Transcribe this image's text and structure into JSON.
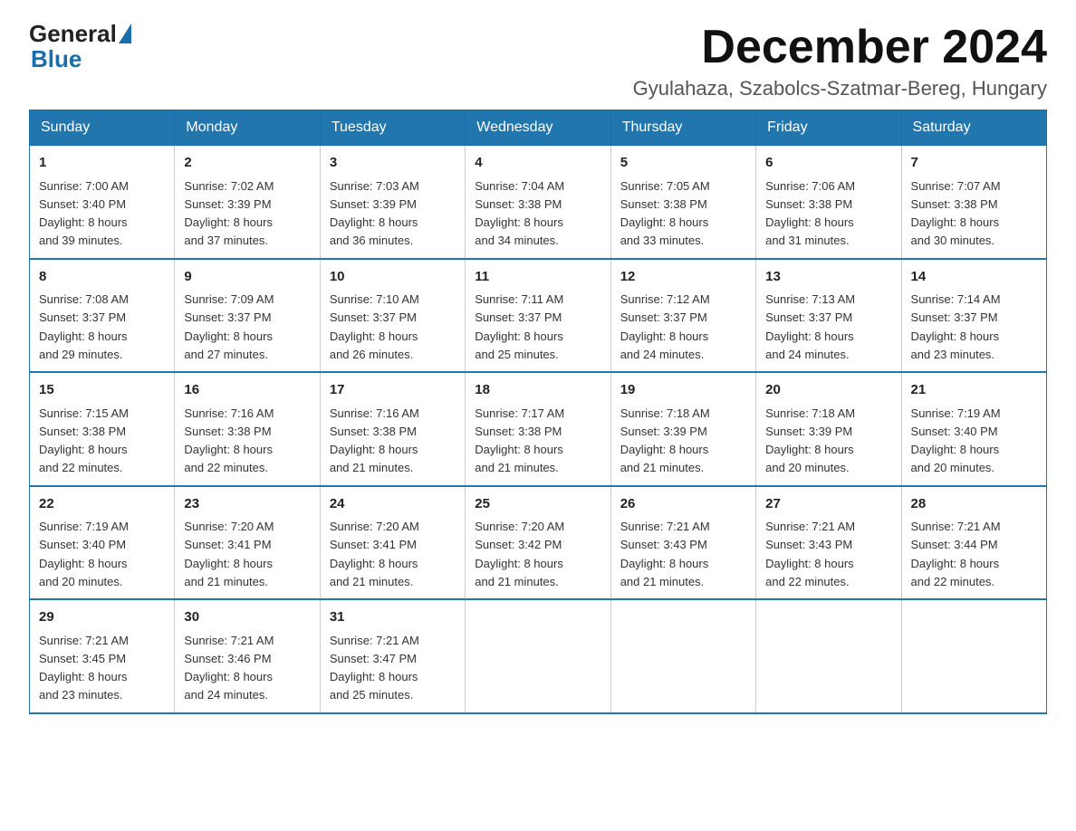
{
  "logo": {
    "general": "General",
    "blue": "Blue"
  },
  "header": {
    "month": "December 2024",
    "location": "Gyulahaza, Szabolcs-Szatmar-Bereg, Hungary"
  },
  "weekdays": [
    "Sunday",
    "Monday",
    "Tuesday",
    "Wednesday",
    "Thursday",
    "Friday",
    "Saturday"
  ],
  "weeks": [
    [
      {
        "day": "1",
        "sunrise": "7:00 AM",
        "sunset": "3:40 PM",
        "daylight": "8 hours and 39 minutes."
      },
      {
        "day": "2",
        "sunrise": "7:02 AM",
        "sunset": "3:39 PM",
        "daylight": "8 hours and 37 minutes."
      },
      {
        "day": "3",
        "sunrise": "7:03 AM",
        "sunset": "3:39 PM",
        "daylight": "8 hours and 36 minutes."
      },
      {
        "day": "4",
        "sunrise": "7:04 AM",
        "sunset": "3:38 PM",
        "daylight": "8 hours and 34 minutes."
      },
      {
        "day": "5",
        "sunrise": "7:05 AM",
        "sunset": "3:38 PM",
        "daylight": "8 hours and 33 minutes."
      },
      {
        "day": "6",
        "sunrise": "7:06 AM",
        "sunset": "3:38 PM",
        "daylight": "8 hours and 31 minutes."
      },
      {
        "day": "7",
        "sunrise": "7:07 AM",
        "sunset": "3:38 PM",
        "daylight": "8 hours and 30 minutes."
      }
    ],
    [
      {
        "day": "8",
        "sunrise": "7:08 AM",
        "sunset": "3:37 PM",
        "daylight": "8 hours and 29 minutes."
      },
      {
        "day": "9",
        "sunrise": "7:09 AM",
        "sunset": "3:37 PM",
        "daylight": "8 hours and 27 minutes."
      },
      {
        "day": "10",
        "sunrise": "7:10 AM",
        "sunset": "3:37 PM",
        "daylight": "8 hours and 26 minutes."
      },
      {
        "day": "11",
        "sunrise": "7:11 AM",
        "sunset": "3:37 PM",
        "daylight": "8 hours and 25 minutes."
      },
      {
        "day": "12",
        "sunrise": "7:12 AM",
        "sunset": "3:37 PM",
        "daylight": "8 hours and 24 minutes."
      },
      {
        "day": "13",
        "sunrise": "7:13 AM",
        "sunset": "3:37 PM",
        "daylight": "8 hours and 24 minutes."
      },
      {
        "day": "14",
        "sunrise": "7:14 AM",
        "sunset": "3:37 PM",
        "daylight": "8 hours and 23 minutes."
      }
    ],
    [
      {
        "day": "15",
        "sunrise": "7:15 AM",
        "sunset": "3:38 PM",
        "daylight": "8 hours and 22 minutes."
      },
      {
        "day": "16",
        "sunrise": "7:16 AM",
        "sunset": "3:38 PM",
        "daylight": "8 hours and 22 minutes."
      },
      {
        "day": "17",
        "sunrise": "7:16 AM",
        "sunset": "3:38 PM",
        "daylight": "8 hours and 21 minutes."
      },
      {
        "day": "18",
        "sunrise": "7:17 AM",
        "sunset": "3:38 PM",
        "daylight": "8 hours and 21 minutes."
      },
      {
        "day": "19",
        "sunrise": "7:18 AM",
        "sunset": "3:39 PM",
        "daylight": "8 hours and 21 minutes."
      },
      {
        "day": "20",
        "sunrise": "7:18 AM",
        "sunset": "3:39 PM",
        "daylight": "8 hours and 20 minutes."
      },
      {
        "day": "21",
        "sunrise": "7:19 AM",
        "sunset": "3:40 PM",
        "daylight": "8 hours and 20 minutes."
      }
    ],
    [
      {
        "day": "22",
        "sunrise": "7:19 AM",
        "sunset": "3:40 PM",
        "daylight": "8 hours and 20 minutes."
      },
      {
        "day": "23",
        "sunrise": "7:20 AM",
        "sunset": "3:41 PM",
        "daylight": "8 hours and 21 minutes."
      },
      {
        "day": "24",
        "sunrise": "7:20 AM",
        "sunset": "3:41 PM",
        "daylight": "8 hours and 21 minutes."
      },
      {
        "day": "25",
        "sunrise": "7:20 AM",
        "sunset": "3:42 PM",
        "daylight": "8 hours and 21 minutes."
      },
      {
        "day": "26",
        "sunrise": "7:21 AM",
        "sunset": "3:43 PM",
        "daylight": "8 hours and 21 minutes."
      },
      {
        "day": "27",
        "sunrise": "7:21 AM",
        "sunset": "3:43 PM",
        "daylight": "8 hours and 22 minutes."
      },
      {
        "day": "28",
        "sunrise": "7:21 AM",
        "sunset": "3:44 PM",
        "daylight": "8 hours and 22 minutes."
      }
    ],
    [
      {
        "day": "29",
        "sunrise": "7:21 AM",
        "sunset": "3:45 PM",
        "daylight": "8 hours and 23 minutes."
      },
      {
        "day": "30",
        "sunrise": "7:21 AM",
        "sunset": "3:46 PM",
        "daylight": "8 hours and 24 minutes."
      },
      {
        "day": "31",
        "sunrise": "7:21 AM",
        "sunset": "3:47 PM",
        "daylight": "8 hours and 25 minutes."
      },
      null,
      null,
      null,
      null
    ]
  ],
  "labels": {
    "sunrise": "Sunrise:",
    "sunset": "Sunset:",
    "daylight": "Daylight:"
  }
}
